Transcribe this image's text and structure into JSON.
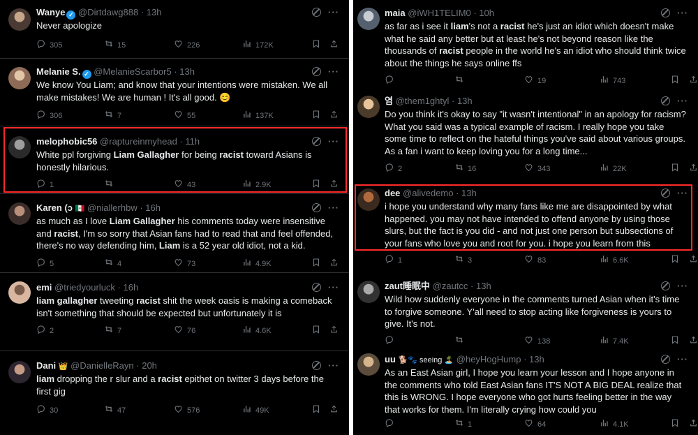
{
  "left_tweets": [
    {
      "name": "Wanye",
      "verified": true,
      "badge": "",
      "handle": "@Dirtdawg888",
      "time": "13h",
      "text_html": "Never apologize",
      "replies": "305",
      "reposts": "15",
      "likes": "226",
      "views": "172K"
    },
    {
      "name": "Melanie S.",
      "verified": true,
      "badge": "",
      "handle": "@MelanieScarbor5",
      "time": "13h",
      "text_html": "We know You Liam; and know that your intentions were mistaken. We all make mistakes! We are human ! It's all good. 😊",
      "replies": "306",
      "reposts": "7",
      "likes": "55",
      "views": "137K"
    },
    {
      "name": "melophobic56",
      "verified": false,
      "badge": "",
      "handle": "@raptureinmyhead",
      "time": "11h",
      "text_html": "White ppl forgiving <b>Liam Gallagher</b> for being <b>racist</b> toward Asians is honestly hilarious.",
      "replies": "1",
      "reposts": "",
      "likes": "43",
      "views": "2.9K"
    },
    {
      "name": "Karen (ɔ",
      "verified": false,
      "badge": "🇲🇽",
      "handle": "@niallerhbw",
      "time": "16h",
      "text_html": "as much as I love <b>Liam Gallagher</b> his comments today were insensitive and <b>racist</b>, I'm so sorry that Asian fans had to read that and feel offended, there's no way defending him, <b>Liam</b> is a 52 year old idiot, not a kid.",
      "replies": "5",
      "reposts": "4",
      "likes": "73",
      "views": "4.9K"
    },
    {
      "name": "emi",
      "verified": false,
      "badge": "",
      "handle": "@triedyourluck",
      "time": "16h",
      "text_html": "<b>liam gallagher</b> tweeting <b>racist</b> shit the week oasis is making a comeback isn't something that should be expected but unfortunately it is",
      "replies": "2",
      "reposts": "7",
      "likes": "76",
      "views": "4.6K"
    },
    {
      "name": "Dani",
      "verified": false,
      "badge": "👑",
      "handle": "@DanielleRayn",
      "time": "20h",
      "text_html": "<b>liam</b> dropping the r slur and a <b>racist</b> epithet on twitter 3 days before the first gig",
      "replies": "30",
      "reposts": "47",
      "likes": "576",
      "views": "49K"
    }
  ],
  "right_tweets": [
    {
      "name": "maia",
      "verified": false,
      "badge": "",
      "handle": "@iWH1TELIM0",
      "time": "10h",
      "text_html": "as far as i see it <b>liam</b>'s not a <b>racist</b> he's just an idiot which doesn't make what he said any better but at least he's not beyond reason like the thousands of <b>racist</b> people in the world he's an idiot who should think twice about the things he says online ffs",
      "replies": "",
      "reposts": "",
      "likes": "19",
      "views": "743"
    },
    {
      "name": "염",
      "verified": false,
      "badge": "",
      "handle": "@them1ghtyl",
      "time": "13h",
      "text_html": "Do you think it's okay to say \"it wasn't intentional\" in an apology for racism? What you said was a typical example of racism. I really hope you take some time to reflect on the hateful things you've said about various groups. As a fan i want to keep loving you for a long time...",
      "replies": "2",
      "reposts": "16",
      "likes": "343",
      "views": "22K"
    },
    {
      "name": "dee",
      "verified": false,
      "badge": "",
      "handle": "@alivedemo",
      "time": "13h",
      "text_html": "i hope you understand why many fans like me are disappointed by what happened. you may not have intended to offend anyone by using those slurs, but the fact is you did - and not just one person but subsections of your fans who love you and root for you. i hope you learn from this",
      "replies": "1",
      "reposts": "3",
      "likes": "83",
      "views": "6.6K"
    },
    {
      "name": "zaut睡眠中",
      "verified": false,
      "badge": "",
      "handle": "@zautcc",
      "time": "13h",
      "text_html": "Wild how suddenly everyone in the comments turned Asian when it's time to forgive someone. Y'all need to stop acting like forgiveness is yours to give. It's not.",
      "replies": "",
      "reposts": "",
      "likes": "138",
      "views": "7.4K"
    },
    {
      "name": "uu",
      "verified": false,
      "badge": "🐕🐾 seeing 🏝️",
      "handle": "@heyHogHump",
      "time": "13h",
      "text_html": "As an East Asian girl, I hope you learn your lesson and I hope anyone in the comments who told East Asian fans IT'S NOT A BIG DEAL realize that this is WRONG. I hope everyone who got hurts feeling better in the way that works for them. I'm literally crying how could you",
      "replies": "",
      "reposts": "1",
      "likes": "64",
      "views": "4.1K"
    }
  ],
  "icons": {
    "reply": "reply-icon",
    "repost": "repost-icon",
    "like": "like-icon",
    "views": "views-icon",
    "bookmark": "bookmark-icon",
    "share": "share-icon",
    "grok": "grok-icon",
    "more": "more-icon"
  },
  "colors": {
    "background": "#000000",
    "text": "#e7e9ea",
    "muted": "#71767b",
    "verified": "#1d9bf0",
    "highlight_box": "#ff2a2a"
  }
}
